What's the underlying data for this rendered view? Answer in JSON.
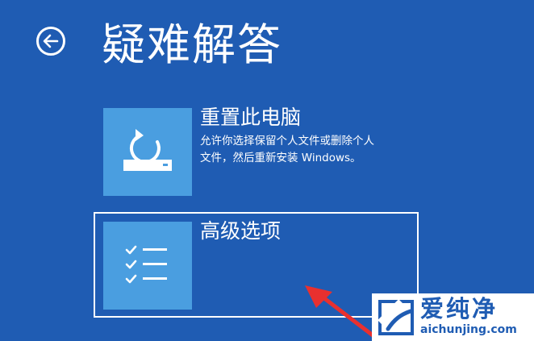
{
  "header": {
    "back_icon": "back-arrow-icon",
    "title": "疑难解答"
  },
  "options": [
    {
      "icon": "reset-pc-icon",
      "title": "重置此电脑",
      "description_lines": [
        "允许你选择保留个人文件或删除个人",
        "文件，然后重新安装 Windows。"
      ]
    },
    {
      "icon": "checklist-icon",
      "title": "高级选项",
      "selected": true
    }
  ],
  "watermark": {
    "name": "爱纯净",
    "domain": "aichunjing.com"
  },
  "colors": {
    "background": "#1f5cb3",
    "tile": "#4a9ee0",
    "arrow": "#e8302f",
    "text": "#ffffff"
  }
}
